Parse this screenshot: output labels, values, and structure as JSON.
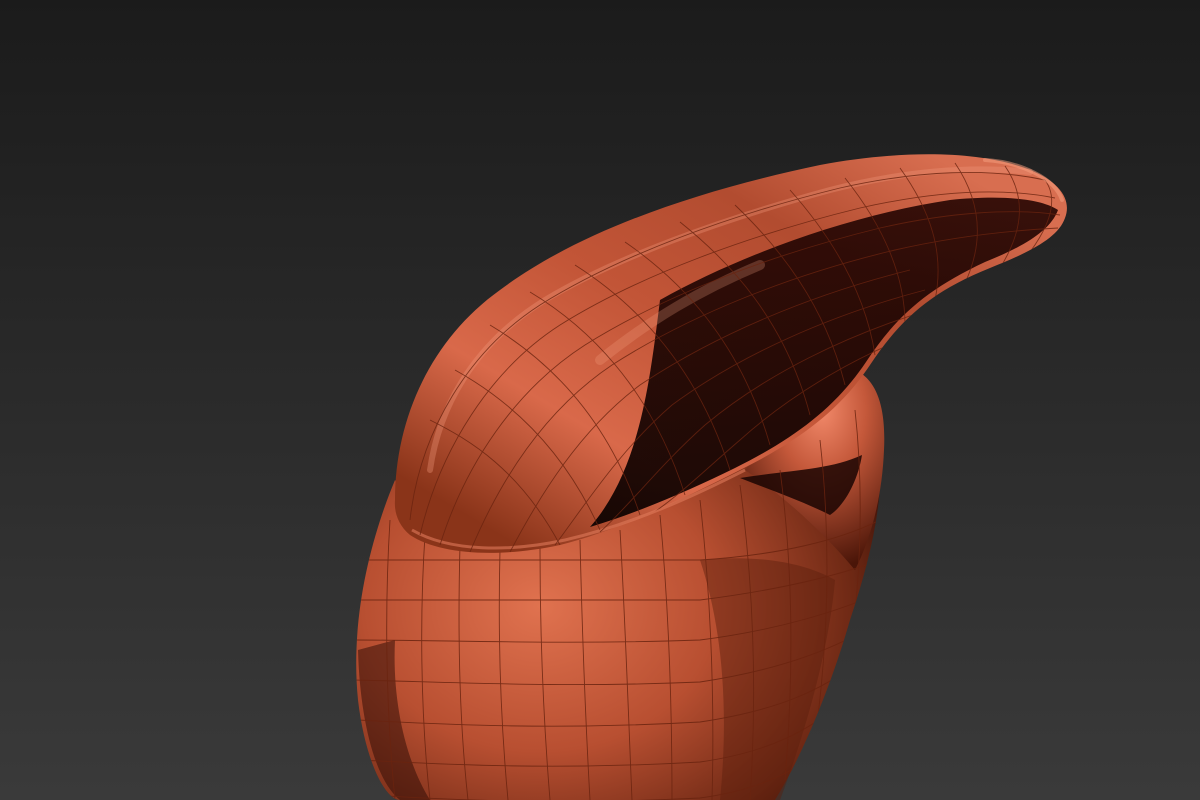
{
  "viewport": {
    "background_top": "#1b1b1b",
    "background_bottom": "#3a3a3a"
  },
  "model": {
    "surface_color": "#c4583a",
    "highlight_color": "#f08a6a",
    "shadow_color": "#120302",
    "wireframe_color": "#6a2410",
    "wireframe_visible": true,
    "shading": "smooth"
  }
}
